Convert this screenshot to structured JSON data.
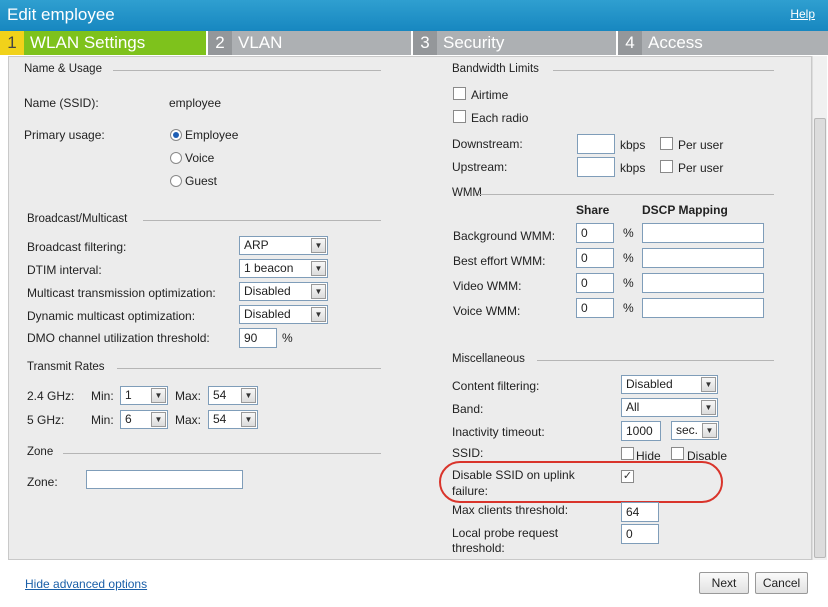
{
  "window": {
    "title": "Edit employee",
    "help": "Help"
  },
  "tabs": [
    {
      "num": "1",
      "label": "WLAN Settings"
    },
    {
      "num": "2",
      "label": "VLAN"
    },
    {
      "num": "3",
      "label": "Security"
    },
    {
      "num": "4",
      "label": "Access"
    }
  ],
  "name_usage": {
    "section": "Name & Usage",
    "ssid_label": "Name (SSID):",
    "ssid_value": "employee",
    "usage_label": "Primary usage:",
    "options": [
      "Employee",
      "Voice",
      "Guest"
    ],
    "selected": "Employee"
  },
  "broadcast": {
    "section": "Broadcast/Multicast",
    "filtering_label": "Broadcast filtering:",
    "filtering_value": "ARP",
    "dtim_label": "DTIM interval:",
    "dtim_value": "1 beacon",
    "mto_label": "Multicast transmission optimization:",
    "mto_value": "Disabled",
    "dmo_label": "Dynamic multicast optimization:",
    "dmo_value": "Disabled",
    "dmo_threshold_label": "DMO channel utilization threshold:",
    "dmo_threshold_value": "90",
    "pct": "%"
  },
  "transmit": {
    "section": "Transmit Rates",
    "g24_label": "2.4 GHz:",
    "g5_label": "5 GHz:",
    "min": "Min:",
    "max": "Max:",
    "g24_min": "1",
    "g24_max": "54",
    "g5_min": "6",
    "g5_max": "54"
  },
  "zone": {
    "section": "Zone",
    "label": "Zone:",
    "value": ""
  },
  "bandwidth": {
    "section": "Bandwidth Limits",
    "airtime": "Airtime",
    "each_radio": "Each radio",
    "downstream": "Downstream:",
    "upstream": "Upstream:",
    "unit": "kbps",
    "per_user": "Per user"
  },
  "wmm": {
    "section": "WMM",
    "share": "Share",
    "dscp": "DSCP Mapping",
    "pct": "%",
    "rows": [
      {
        "label": "Background WMM:",
        "share": "0",
        "dscp": ""
      },
      {
        "label": "Best effort WMM:",
        "share": "0",
        "dscp": ""
      },
      {
        "label": "Video WMM:",
        "share": "0",
        "dscp": ""
      },
      {
        "label": "Voice WMM:",
        "share": "0",
        "dscp": ""
      }
    ]
  },
  "misc": {
    "section": "Miscellaneous",
    "content_label": "Content filtering:",
    "content_value": "Disabled",
    "band_label": "Band:",
    "band_value": "All",
    "inactivity_label": "Inactivity timeout:",
    "inactivity_value": "1000",
    "inactivity_unit": "sec.",
    "ssid_label": "SSID:",
    "hide": "Hide",
    "disable": "Disable",
    "uplink_line1": "Disable SSID on uplink",
    "uplink_line2": "failure:",
    "uplink_checked": "✓",
    "max_clients_label": "Max clients threshold:",
    "max_clients_value": "64",
    "probe_line1": "Local probe request",
    "probe_line2": "threshold:",
    "probe_value": "0"
  },
  "footer": {
    "hide_advanced": "Hide advanced options",
    "next": "Next",
    "cancel": "Cancel"
  },
  "colors": {
    "titlebar": "#1787c0",
    "active_tab": "#7ec21c",
    "active_num": "#f1d21a",
    "tab": "#adb0b3",
    "highlight": "#d9342b"
  }
}
